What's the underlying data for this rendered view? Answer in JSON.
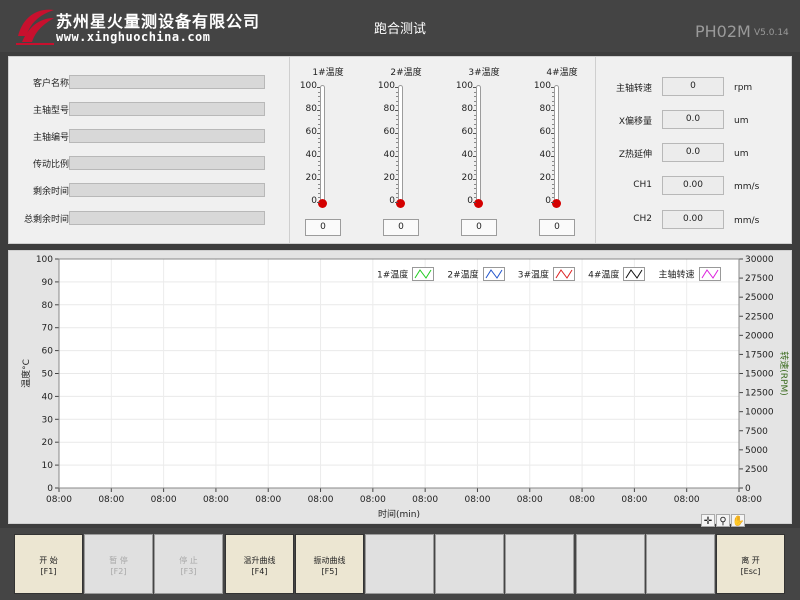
{
  "header": {
    "company_name": "苏州星火量测设备有限公司",
    "company_url": "www.xinghuochina.com",
    "window_title": "跑合测试",
    "model": "PH02M",
    "version": "V5.0.14"
  },
  "info_fields": [
    {
      "label": "客户名称",
      "value": ""
    },
    {
      "label": "主轴型号",
      "value": ""
    },
    {
      "label": "主轴编号",
      "value": ""
    },
    {
      "label": "传动比例",
      "value": ""
    },
    {
      "label": "剩余时间",
      "value": ""
    },
    {
      "label": "总剩余时间",
      "value": ""
    }
  ],
  "thermometers": [
    {
      "title": "1#温度",
      "value": "0",
      "level": 0
    },
    {
      "title": "2#温度",
      "value": "0",
      "level": 0
    },
    {
      "title": "3#温度",
      "value": "0",
      "level": 0
    },
    {
      "title": "4#温度",
      "value": "0",
      "level": 0
    }
  ],
  "thermometer_ticks": [
    "100",
    "80",
    "60",
    "40",
    "20",
    "0"
  ],
  "readings": [
    {
      "label": "主轴转速",
      "value": "0",
      "unit": "rpm"
    },
    {
      "label": "X偏移量",
      "value": "0.0",
      "unit": "um"
    },
    {
      "label": "Z热延伸",
      "value": "0.0",
      "unit": "um"
    },
    {
      "label": "CH1",
      "value": "0.00",
      "unit": "mm/s"
    },
    {
      "label": "CH2",
      "value": "0.00",
      "unit": "mm/s"
    }
  ],
  "chart_data": {
    "type": "line",
    "xlabel": "时间(min)",
    "ylabel": "温度°C",
    "y2label": "转速(RPM)",
    "ylim": [
      0,
      100
    ],
    "y2lim": [
      0,
      30000
    ],
    "yticks": [
      "0",
      "10",
      "20",
      "30",
      "40",
      "50",
      "60",
      "70",
      "80",
      "90",
      "100"
    ],
    "y2ticks": [
      "0",
      "2500",
      "5000",
      "7500",
      "10000",
      "12500",
      "15000",
      "17500",
      "20000",
      "22500",
      "25000",
      "27500",
      "30000"
    ],
    "xticks": [
      "08:00",
      "08:00",
      "08:00",
      "08:00",
      "08:00",
      "08:00",
      "08:00",
      "08:00",
      "08:00",
      "08:00",
      "08:00",
      "08:00",
      "08:00",
      "08:00"
    ],
    "grid": true,
    "legend_position": "top-right",
    "series": [
      {
        "name": "1#温度",
        "color": "#22cc22",
        "values": []
      },
      {
        "name": "2#温度",
        "color": "#2255cc",
        "values": []
      },
      {
        "name": "3#温度",
        "color": "#dd2222",
        "values": []
      },
      {
        "name": "4#温度",
        "color": "#111111",
        "values": []
      },
      {
        "name": "主轴转速",
        "color": "#dd22dd",
        "values": []
      }
    ]
  },
  "function_keys": [
    {
      "label": "开 始",
      "key": "[F1]",
      "enabled": true
    },
    {
      "label": "暂 停",
      "key": "[F2]",
      "enabled": false
    },
    {
      "label": "停 止",
      "key": "[F3]",
      "enabled": false
    },
    {
      "label": "温升曲线",
      "key": "[F4]",
      "enabled": true
    },
    {
      "label": "振动曲线",
      "key": "[F5]",
      "enabled": true
    },
    {
      "label": "",
      "key": "",
      "enabled": false
    },
    {
      "label": "",
      "key": "",
      "enabled": false
    },
    {
      "label": "",
      "key": "",
      "enabled": false
    },
    {
      "label": "",
      "key": "",
      "enabled": false
    },
    {
      "label": "",
      "key": "",
      "enabled": false
    },
    {
      "label": "离 开",
      "key": "[Esc]",
      "enabled": true
    }
  ],
  "colors": {
    "thermometer_bulb": "#d40000",
    "chart_axis_right": "#3a6b1e"
  }
}
